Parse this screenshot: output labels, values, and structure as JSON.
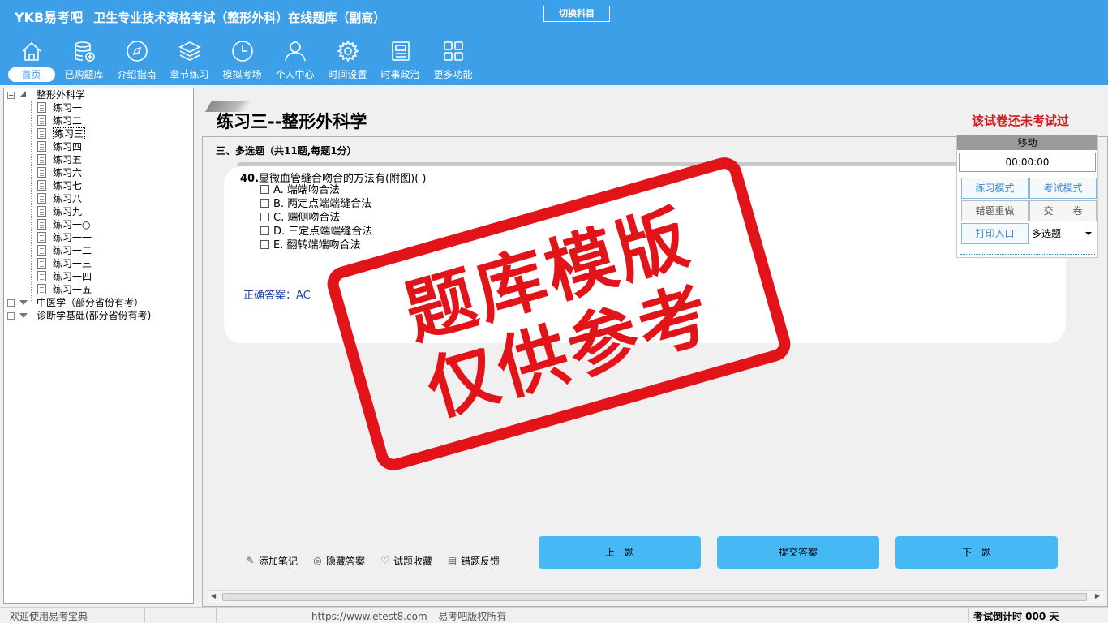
{
  "header": {
    "brand": "YKB易考吧",
    "subtitle": "卫生专业技术资格考试（整形外科）在线题库（副高）",
    "switch_label": "切换科目"
  },
  "nav": {
    "items": [
      {
        "label": "首页",
        "icon": "home-icon"
      },
      {
        "label": "已购题库",
        "icon": "database-icon"
      },
      {
        "label": "介绍指南",
        "icon": "compass-icon"
      },
      {
        "label": "章节练习",
        "icon": "layers-icon"
      },
      {
        "label": "模拟考场",
        "icon": "clock-icon"
      },
      {
        "label": "个人中心",
        "icon": "user-icon"
      },
      {
        "label": "时间设置",
        "icon": "gear-icon"
      },
      {
        "label": "时事政治",
        "icon": "newspaper-icon"
      },
      {
        "label": "更多功能",
        "icon": "grid-icon"
      }
    ]
  },
  "tree": {
    "root": "整形外科学",
    "children": [
      "练习一",
      "练习二",
      "练习三",
      "练习四",
      "练习五",
      "练习六",
      "练习七",
      "练习八",
      "练习九",
      "练习一○",
      "练习一一",
      "练习一二",
      "练习一三",
      "练习一四",
      "练习一五"
    ],
    "selected_index": 2,
    "others": [
      "中医学（部分省份有考）",
      "诊断学基础(部分省份有考)"
    ]
  },
  "paper": {
    "title": "练习三--整形外科学",
    "status": "该试卷还未考试过"
  },
  "question": {
    "section": "三、多选题（共11题,每题1分）",
    "number": "40.",
    "text": "显微血管缝合吻合的方法有(附图)( )",
    "options": [
      "A. 端端吻合法",
      "B. 两定点端端缝合法",
      "C. 端侧吻合法",
      "D. 三定点端端缝合法",
      "E. 翻转端端吻合法"
    ],
    "answer_label": "正确答案：",
    "answer_value": "AC"
  },
  "tools": [
    {
      "label": "添加笔记",
      "icon": "pencil-icon"
    },
    {
      "label": "隐藏答案",
      "icon": "eye-icon"
    },
    {
      "label": "试题收藏",
      "icon": "heart-icon"
    },
    {
      "label": "错题反馈",
      "icon": "feedback-icon"
    }
  ],
  "buttons": {
    "prev": "上一题",
    "submit": "提交答案",
    "next": "下一题"
  },
  "exam_panel": {
    "move_label": "移动",
    "timer": "00:00:00",
    "practice_mode": "练习模式",
    "exam_mode": "考试模式",
    "redo_wrong": "错题重做",
    "hand_in": "交　　卷",
    "print": "打印入口",
    "type_select": "多选题"
  },
  "watermark": {
    "line1": "题库模版",
    "line2": "仅供参考"
  },
  "statusbar": {
    "welcome": "欢迎使用易考宝典",
    "copyright": "https://www.etest8.com – 易考吧版权所有",
    "countdown": "考试倒计时 000 天"
  }
}
